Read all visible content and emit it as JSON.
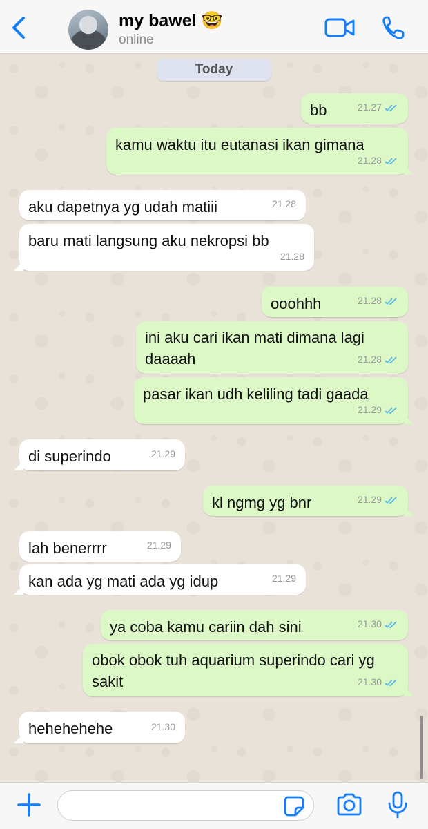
{
  "header": {
    "back_icon": "chevron-left-icon",
    "contact_name": "my bawel 🤓",
    "status": "online",
    "video_icon": "video-camera-icon",
    "call_icon": "phone-icon",
    "accent_color": "#147efb"
  },
  "chat": {
    "date_label": "Today",
    "messages": [
      {
        "direction": "out",
        "text": "bb",
        "time": "21.27",
        "read": true
      },
      {
        "direction": "out",
        "text": "kamu waktu itu eutanasi ikan gimana",
        "time": "21.28",
        "read": true
      },
      {
        "direction": "in",
        "text": "aku dapetnya yg udah matiii",
        "time": "21.28"
      },
      {
        "direction": "in",
        "text": "baru mati langsung aku nekropsi bb",
        "time": "21.28"
      },
      {
        "direction": "out",
        "text": "ooohhh",
        "time": "21.28",
        "read": true
      },
      {
        "direction": "out",
        "text": "ini aku cari ikan mati dimana lagi daaaah",
        "time": "21.28",
        "read": true
      },
      {
        "direction": "out",
        "text": "pasar ikan udh keliling tadi gaada",
        "time": "21.29",
        "read": true
      },
      {
        "direction": "in",
        "text": "di superindo",
        "time": "21.29"
      },
      {
        "direction": "out",
        "text": "kl ngmg yg bnr",
        "time": "21.29",
        "read": true
      },
      {
        "direction": "in",
        "text": "lah benerrrr",
        "time": "21.29"
      },
      {
        "direction": "in",
        "text": "kan ada yg mati ada yg idup",
        "time": "21.29"
      },
      {
        "direction": "out",
        "text": "ya coba kamu cariin dah sini",
        "time": "21.30",
        "read": true
      },
      {
        "direction": "out",
        "text": "obok obok tuh aquarium superindo cari yg sakit",
        "time": "21.30",
        "read": true
      },
      {
        "direction": "in",
        "text": "hehehehehe",
        "time": "21.30"
      }
    ],
    "outgoing_color": "#dcf8c6",
    "incoming_color": "#ffffff",
    "read_tick_color": "#4fb6ec"
  },
  "footer": {
    "plus_icon": "plus-icon",
    "input_value": "",
    "sticker_icon": "sticker-icon",
    "camera_icon": "camera-icon",
    "mic_icon": "microphone-icon"
  }
}
